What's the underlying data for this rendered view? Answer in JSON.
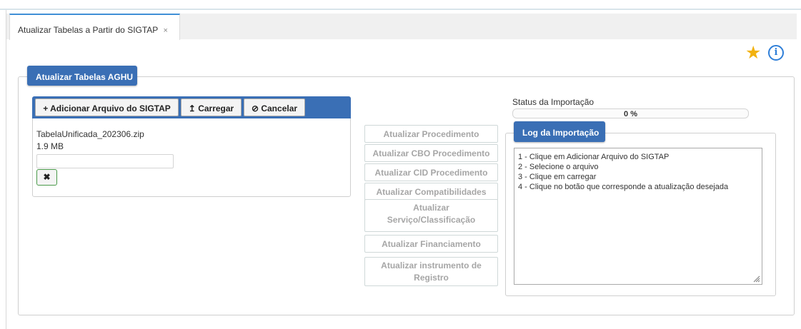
{
  "tab": {
    "label": "Atualizar Tabelas a Partir do SIGTAP",
    "close": "×"
  },
  "header_icons": {
    "favorite": "star-icon",
    "info": "info-icon"
  },
  "main_panel": {
    "legend": "Atualizar Tabelas AGHU"
  },
  "upload": {
    "add_label": "Adicionar Arquivo do SIGTAP",
    "add_icon": "+",
    "load_label": "Carregar",
    "load_icon": "↥",
    "cancel_label": "Cancelar",
    "cancel_icon": "⊘",
    "file": {
      "name": "TabelaUnificada_202306.zip",
      "size": "1.9 MB"
    },
    "remove_label": "✖"
  },
  "actions": [
    "Atualizar Procedimento",
    "Atualizar CBO Procedimento",
    "Atualizar CID Procedimento",
    "Atualizar Compatibilidades",
    "Atualizar Serviço/Classificação",
    "Atualizar Financiamento",
    "Atualizar instrumento de Registro"
  ],
  "status": {
    "label": "Status da Importação",
    "percent_text": "0 %",
    "progress": 0
  },
  "log": {
    "legend": "Log da Importação",
    "lines": [
      "1 - Clique em Adicionar Arquivo do SIGTAP",
      "2 - Selecione o arquivo",
      "3 - Clique em carregar",
      "4 - Clique no botão que corresponde a atualização desejada"
    ]
  },
  "colors": {
    "panel_header": "#3a6fb5",
    "tab_accent": "#3f8fd6",
    "star": "#f2b20f",
    "info": "#2f7fd8"
  }
}
